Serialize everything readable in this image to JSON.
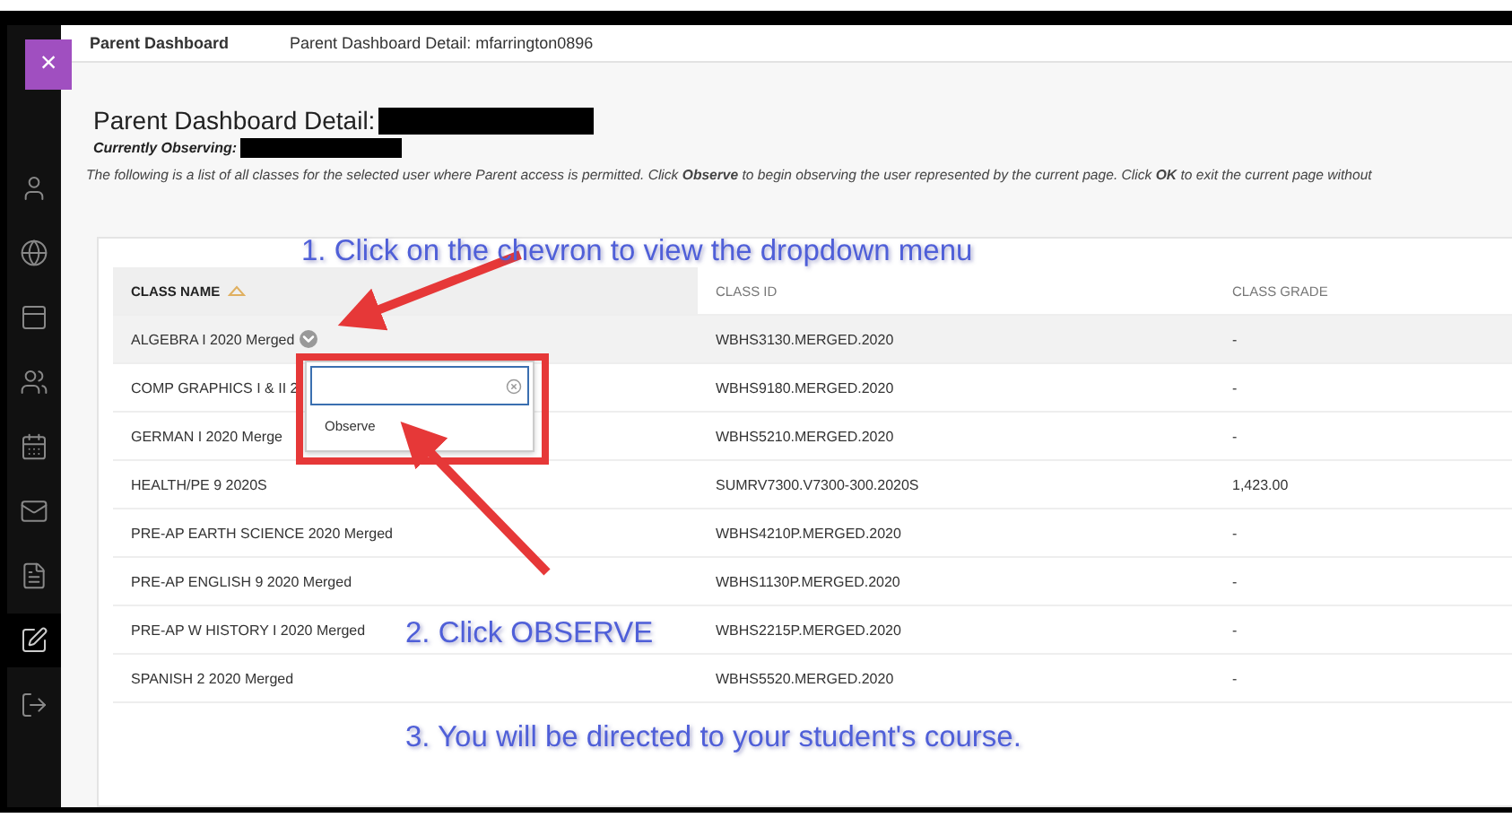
{
  "breadcrumbs": [
    {
      "label": "Parent Dashboard",
      "selected": true
    },
    {
      "label": "Parent Dashboard Detail: mfarrington0896",
      "selected": false
    }
  ],
  "close_button": {
    "label": "×"
  },
  "sidebar": {
    "items": [
      {
        "selected": false
      },
      {
        "selected": false
      },
      {
        "selected": false
      },
      {
        "selected": false
      },
      {
        "selected": false
      },
      {
        "selected": false
      },
      {
        "selected": false
      },
      {
        "selected": true
      },
      {
        "selected": false
      }
    ]
  },
  "page": {
    "title": "Parent Dashboard Detail:",
    "observing_label": "Currently Observing:",
    "description": "The following is a list of all classes for the selected user where Parent access is permitted. Click **Observe** to begin observing the user represented by the current page. Click **OK** to exit the current page without"
  },
  "table": {
    "columns": [
      {
        "label": "CLASS NAME",
        "sorted": true
      },
      {
        "label": "CLASS ID",
        "sorted": false
      },
      {
        "label": "CLASS GRADE",
        "sorted": false
      }
    ],
    "rows": [
      {
        "name": "ALGEBRA I 2020 Merged",
        "id": "WBHS3130.MERGED.2020",
        "grade": "-",
        "highlighted": true
      },
      {
        "name": "COMP GRAPHICS I & II 2",
        "id": "WBHS9180.MERGED.2020",
        "grade": "-",
        "highlighted": false
      },
      {
        "name": "GERMAN I 2020 Merge",
        "id": "WBHS5210.MERGED.2020",
        "grade": "-",
        "highlighted": false
      },
      {
        "name": "HEALTH/PE 9 2020S",
        "id": "SUMRV7300.V7300-300.2020S",
        "grade": "1,423.00",
        "highlighted": false
      },
      {
        "name": "PRE-AP EARTH SCIENCE 2020 Merged",
        "id": "WBHS4210P.MERGED.2020",
        "grade": "-",
        "highlighted": false
      },
      {
        "name": "PRE-AP ENGLISH 9 2020 Merged",
        "id": "WBHS1130P.MERGED.2020",
        "grade": "-",
        "highlighted": false
      },
      {
        "name": "PRE-AP W HISTORY I 2020 Merged",
        "id": "WBHS2215P.MERGED.2020",
        "grade": "-",
        "highlighted": false
      },
      {
        "name": "SPANISH 2 2020 Merged",
        "id": "WBHS5520.MERGED.2020",
        "grade": "-",
        "highlighted": false
      }
    ]
  },
  "dropdown": {
    "items": [
      "Observe"
    ]
  },
  "annotations": [
    "1. Click on the chevron to view the dropdown menu",
    "2. Click OBSERVE",
    "3. You will be directed to your student's course."
  ]
}
